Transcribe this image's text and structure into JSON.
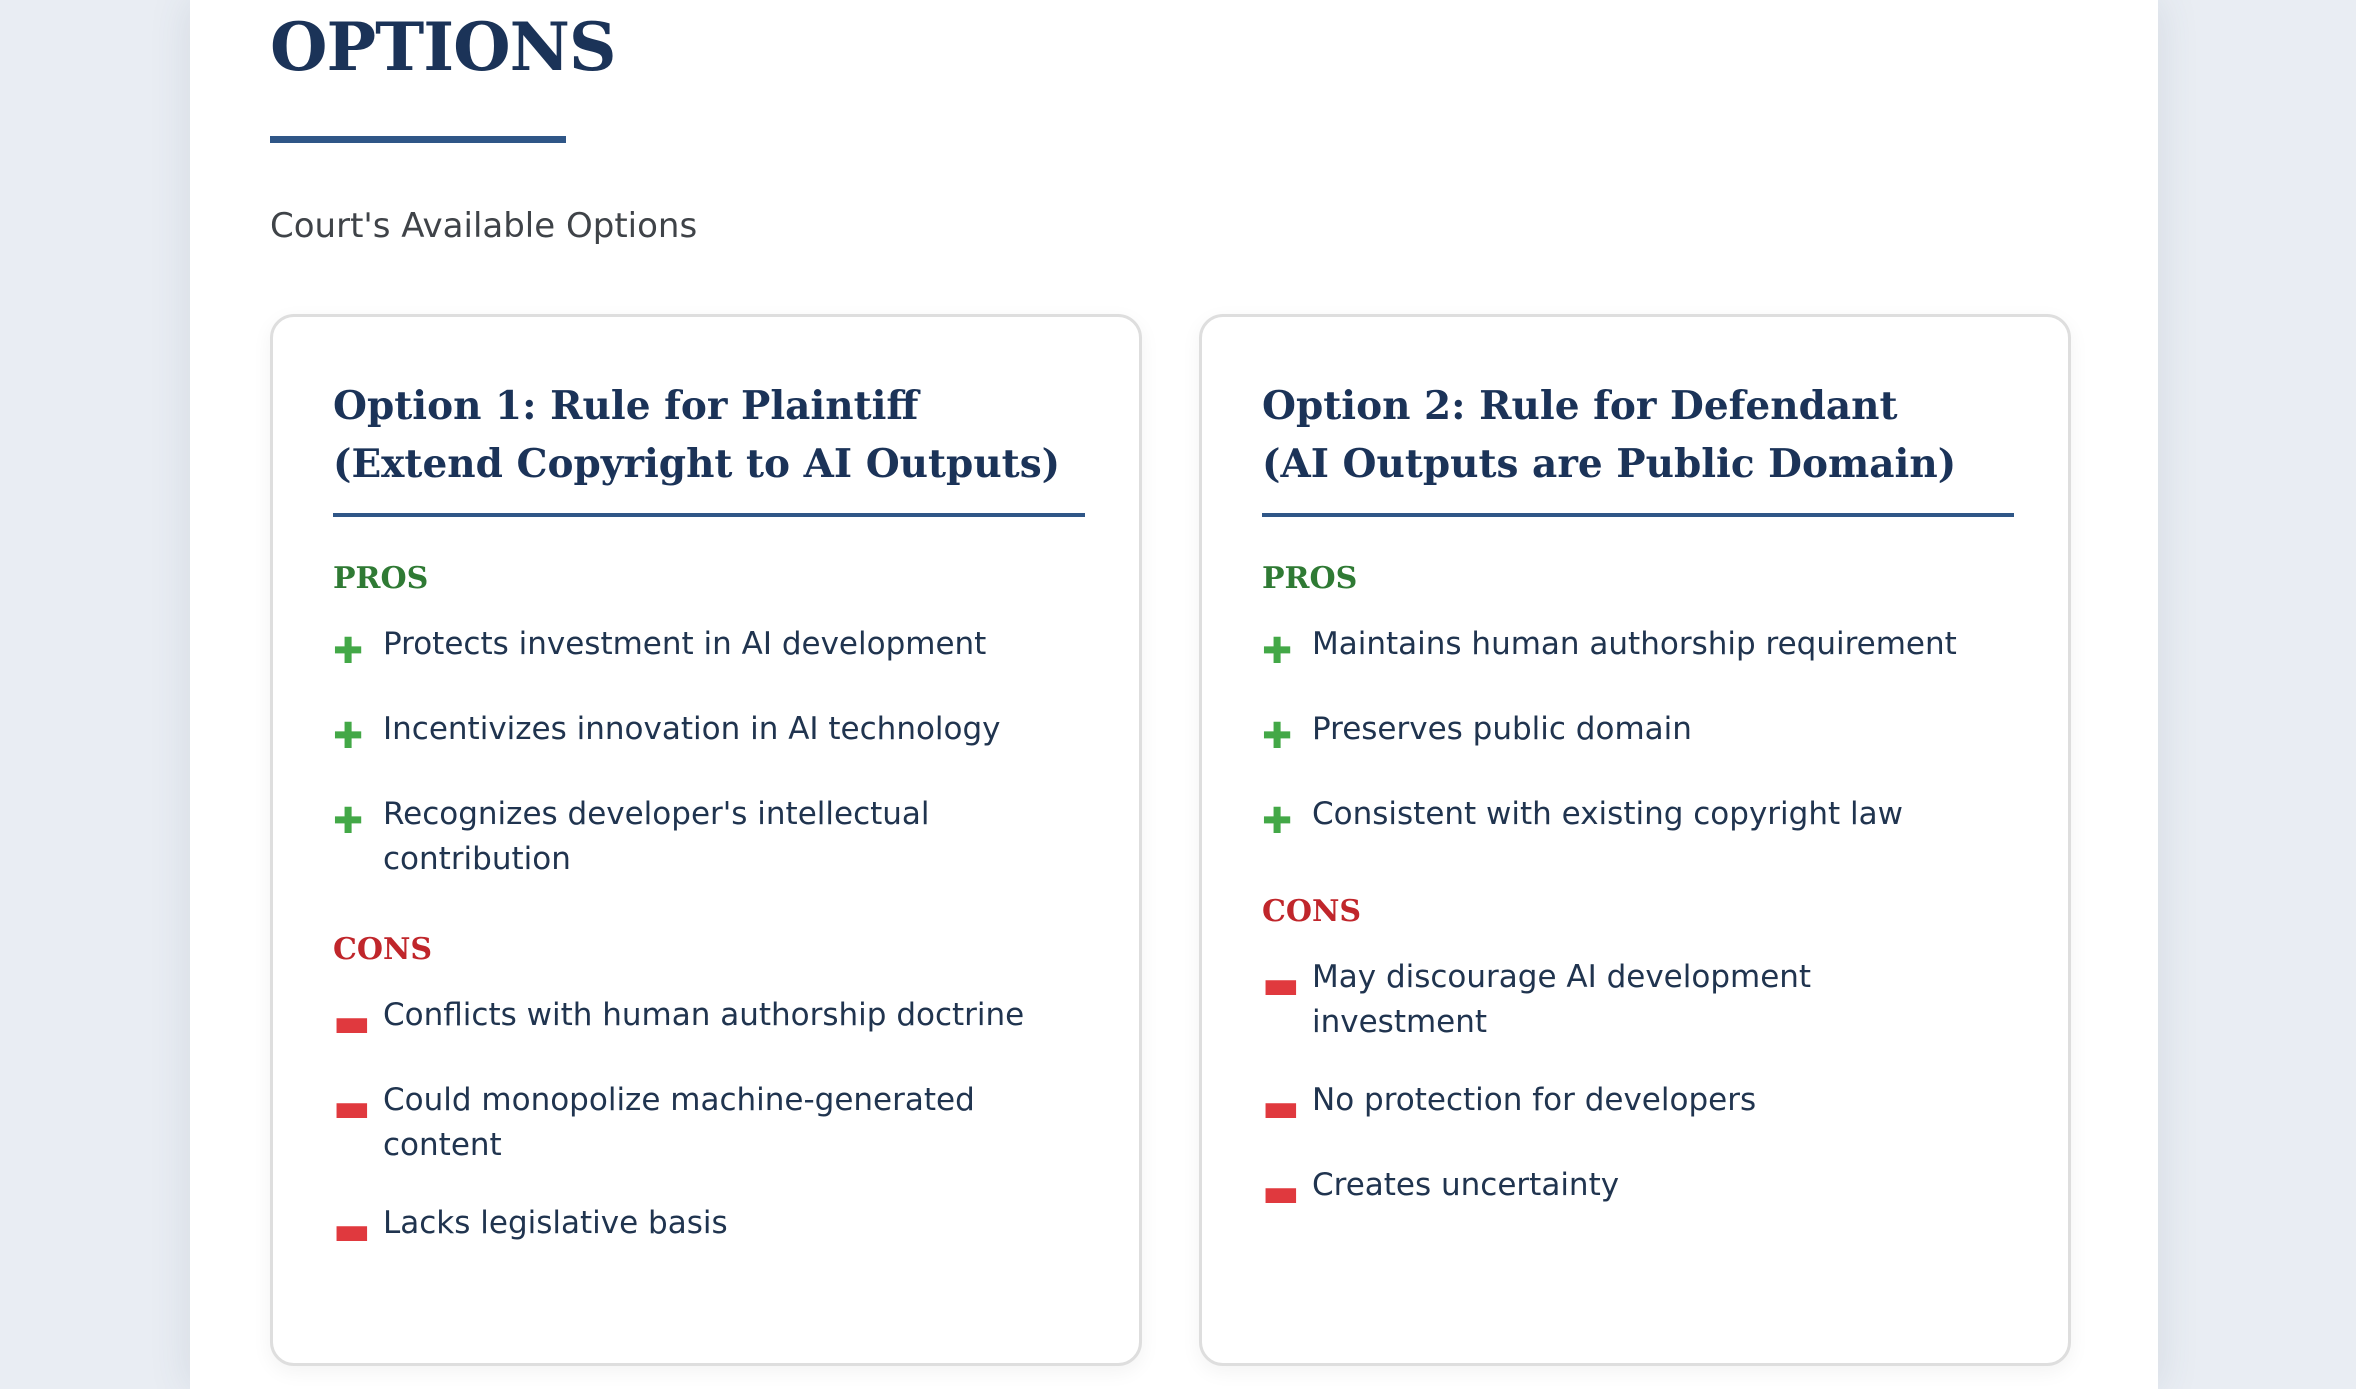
{
  "page": {
    "title": "OPTIONS",
    "subtitle": "Court's Available Options"
  },
  "cards": [
    {
      "title_line1": "Option 1: Rule for Plaintiff",
      "title_line2": "(Extend Copyright to AI Outputs)",
      "pros_label": "PROS",
      "pros": [
        "Protects investment in AI development",
        "Incentivizes innovation in AI technology",
        "Recognizes developer's intellectual contribution"
      ],
      "cons_label": "CONS",
      "cons": [
        "Conflicts with human authorship doctrine",
        "Could monopolize machine-generated content",
        "Lacks legislative basis"
      ]
    },
    {
      "title_line1": "Option 2: Rule for Defendant",
      "title_line2": "(AI Outputs are Public Domain)",
      "pros_label": "PROS",
      "pros": [
        "Maintains human authorship requirement",
        "Preserves public domain",
        "Consistent with existing copyright law"
      ],
      "cons_label": "CONS",
      "cons": [
        "May discourage AI development investment",
        "No protection for developers",
        "Creates uncertainty"
      ]
    }
  ],
  "icons": {
    "pro": "plus-icon",
    "con": "minus-icon"
  },
  "colors": {
    "heading": "#1b3358",
    "accent_rule": "#2f5687",
    "pros": "#2f7a34",
    "cons": "#c0262b",
    "plus_icon": "#43a847",
    "minus_icon": "#e0393e"
  }
}
